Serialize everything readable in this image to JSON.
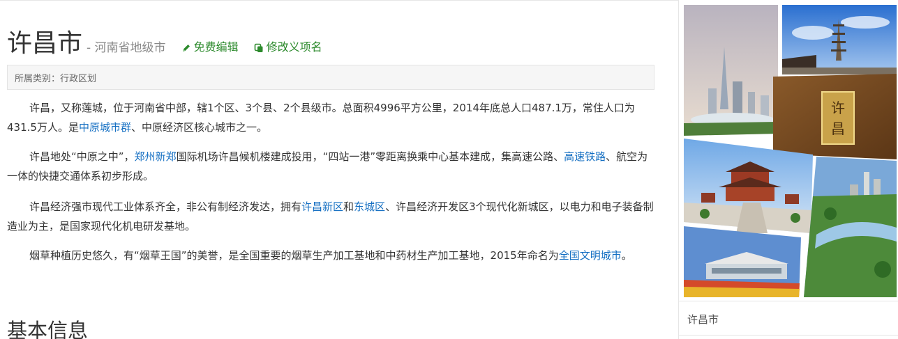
{
  "header": {
    "title": "许昌市",
    "subtitle": "- 河南省地级市",
    "edit_label": "免费编辑",
    "rename_label": "修改义项名"
  },
  "category": {
    "text": "所属类别：行政区划"
  },
  "paragraphs": {
    "p1": {
      "t1": "许昌，又称莲城，位于河南省中部，辖1个区、3个县、2个县级市。总面积4996平方公里，2014年底总人口487.1万，常住人口为431.5万人。是",
      "link1": "中原城市群",
      "t2": "、中原经济区核心城市之一。"
    },
    "p2": {
      "t1": "许昌地处“中原之中”，",
      "link1": "郑州新郑",
      "t2": "国际机场许昌候机楼建成投用，“四站一港”零距离换乘中心基本建成，集高速公路、",
      "link2": "高速铁路",
      "t3": "、航空为一体的快捷交通体系初步形成。"
    },
    "p3": {
      "t1": "许昌经济强市现代工业体系齐全，非公有制经济发达，拥有",
      "link1": "许昌新区",
      "t2": "和",
      "link2": "东城区",
      "t3": "、许昌经济开发区3个现代化新城区，以电力和电子装备制造业为主，是国家现代化机电研发基地。"
    },
    "p4": {
      "t1": "烟草种植历史悠久，有“烟草王国”的美誉，是全国重要的烟草生产加工基地和中药材生产加工基地，2015年命名为",
      "link1": "全国文明城市",
      "t2": "。"
    }
  },
  "section": {
    "heading": "基本信息"
  },
  "sidebar": {
    "image_plaque_text": "许昌",
    "caption": "许昌市"
  },
  "colors": {
    "link": "#136ec2",
    "action_green": "#2c8a2c"
  }
}
